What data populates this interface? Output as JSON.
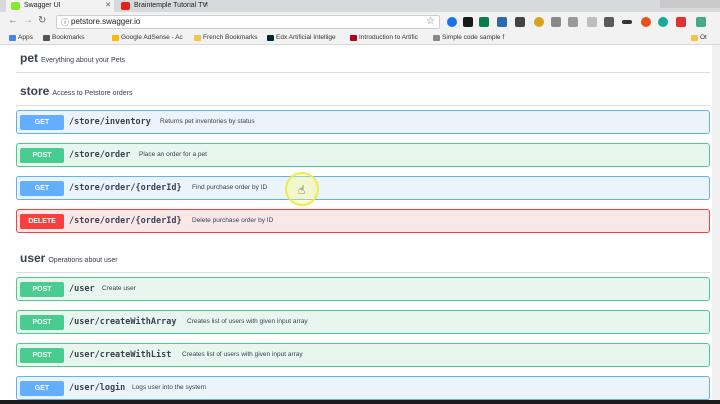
{
  "browser": {
    "tabs": [
      {
        "label": "Swagger UI",
        "favicon_color": "#85ea2d"
      },
      {
        "label": "Braintemple Tutorial TV",
        "favicon_color": "#e62117"
      }
    ],
    "url": "petstore.swagger.io",
    "bookmarks": [
      {
        "label": "Apps",
        "color": "#4285f4"
      },
      {
        "label": "Bookmarks",
        "color": "#555555"
      },
      {
        "label": "Google AdSense - Ac",
        "color": "#fbbc05"
      },
      {
        "label": "French Bookmarks",
        "color": "#f2c54b"
      },
      {
        "label": "Edx Artificial Intellige",
        "color": "#02262b"
      },
      {
        "label": "Introduction to Artific",
        "color": "#b2001e"
      },
      {
        "label": "Simple code sample f",
        "color": "#888888"
      },
      {
        "label": "Ot",
        "color": "#f2c54b"
      }
    ]
  },
  "sections": {
    "pet": {
      "title": "pet",
      "description": "Everything about your Pets"
    },
    "store": {
      "title": "store",
      "description": "Access to Petstore orders"
    },
    "user": {
      "title": "user",
      "description": "Operations about user"
    }
  },
  "operations": [
    {
      "method": "GET",
      "path": "/store/inventory",
      "summary": "Returns pet inventories by status"
    },
    {
      "method": "POST",
      "path": "/store/order",
      "summary": "Place an order for a pet"
    },
    {
      "method": "GET",
      "path": "/store/order/{orderId}",
      "summary": "Find purchase order by ID"
    },
    {
      "method": "DELETE",
      "path": "/store/order/{orderId}",
      "summary": "Delete purchase order by ID"
    },
    {
      "method": "POST",
      "path": "/user",
      "summary": "Create user"
    },
    {
      "method": "POST",
      "path": "/user/createWithArray",
      "summary": "Creates list of users with given input array"
    },
    {
      "method": "POST",
      "path": "/user/createWithList",
      "summary": "Creates list of users with given input array"
    },
    {
      "method": "GET",
      "path": "/user/login",
      "summary": "Logs user into the system"
    }
  ],
  "colors": {
    "get": "#61affe",
    "post": "#49cc90",
    "delete": "#f93e3e"
  }
}
